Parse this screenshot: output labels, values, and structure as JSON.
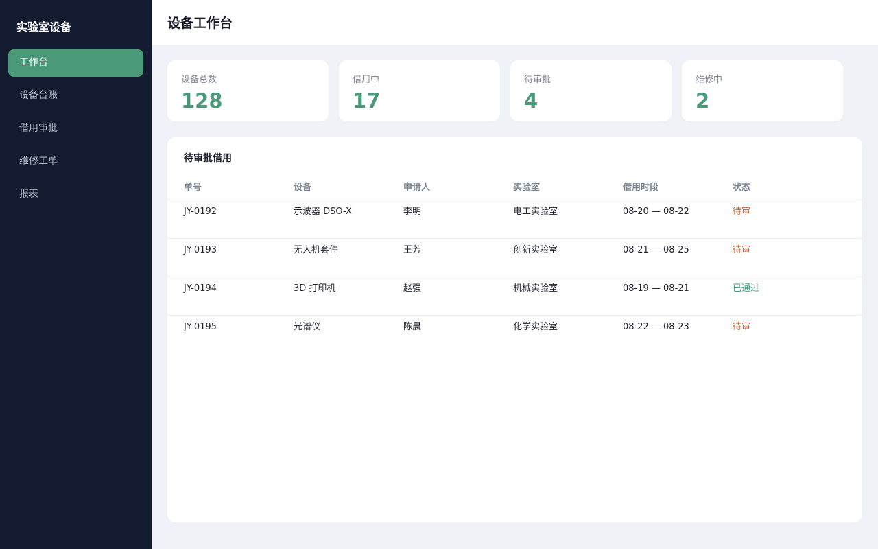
{
  "sidebar": {
    "brand": "实验室设备",
    "items": [
      {
        "label": "工作台",
        "active": true
      },
      {
        "label": "设备台账",
        "active": false
      },
      {
        "label": "借用审批",
        "active": false
      },
      {
        "label": "维修工单",
        "active": false
      },
      {
        "label": "报表",
        "active": false
      }
    ]
  },
  "header": {
    "title": "设备工作台"
  },
  "stats": [
    {
      "label": "设备总数",
      "value": "128"
    },
    {
      "label": "借用中",
      "value": "17"
    },
    {
      "label": "待审批",
      "value": "4"
    },
    {
      "label": "维修中",
      "value": "2"
    }
  ],
  "panel": {
    "title": "待审批借用",
    "columns": [
      "单号",
      "设备",
      "申请人",
      "实验室",
      "借用时段",
      "状态"
    ],
    "rows": [
      {
        "id": "JY-0192",
        "device": "示波器 DSO-X",
        "applicant": "李明",
        "lab": "电工实验室",
        "period": "08-20 — 08-22",
        "status": "待审"
      },
      {
        "id": "JY-0193",
        "device": "无人机套件",
        "applicant": "王芳",
        "lab": "创新实验室",
        "period": "08-21 — 08-25",
        "status": "待审"
      },
      {
        "id": "JY-0194",
        "device": "3D 打印机",
        "applicant": "赵强",
        "lab": "机械实验室",
        "period": "08-19 — 08-21",
        "status": "已通过"
      },
      {
        "id": "JY-0195",
        "device": "光谱仪",
        "applicant": "陈晨",
        "lab": "化学实验室",
        "period": "08-22 — 08-23",
        "status": "待审"
      }
    ]
  },
  "colors": {
    "accent": "#4a9a7a",
    "sidebar_bg": "#121b2f",
    "pending": "#c0622b",
    "approved": "#4a9a7a"
  }
}
